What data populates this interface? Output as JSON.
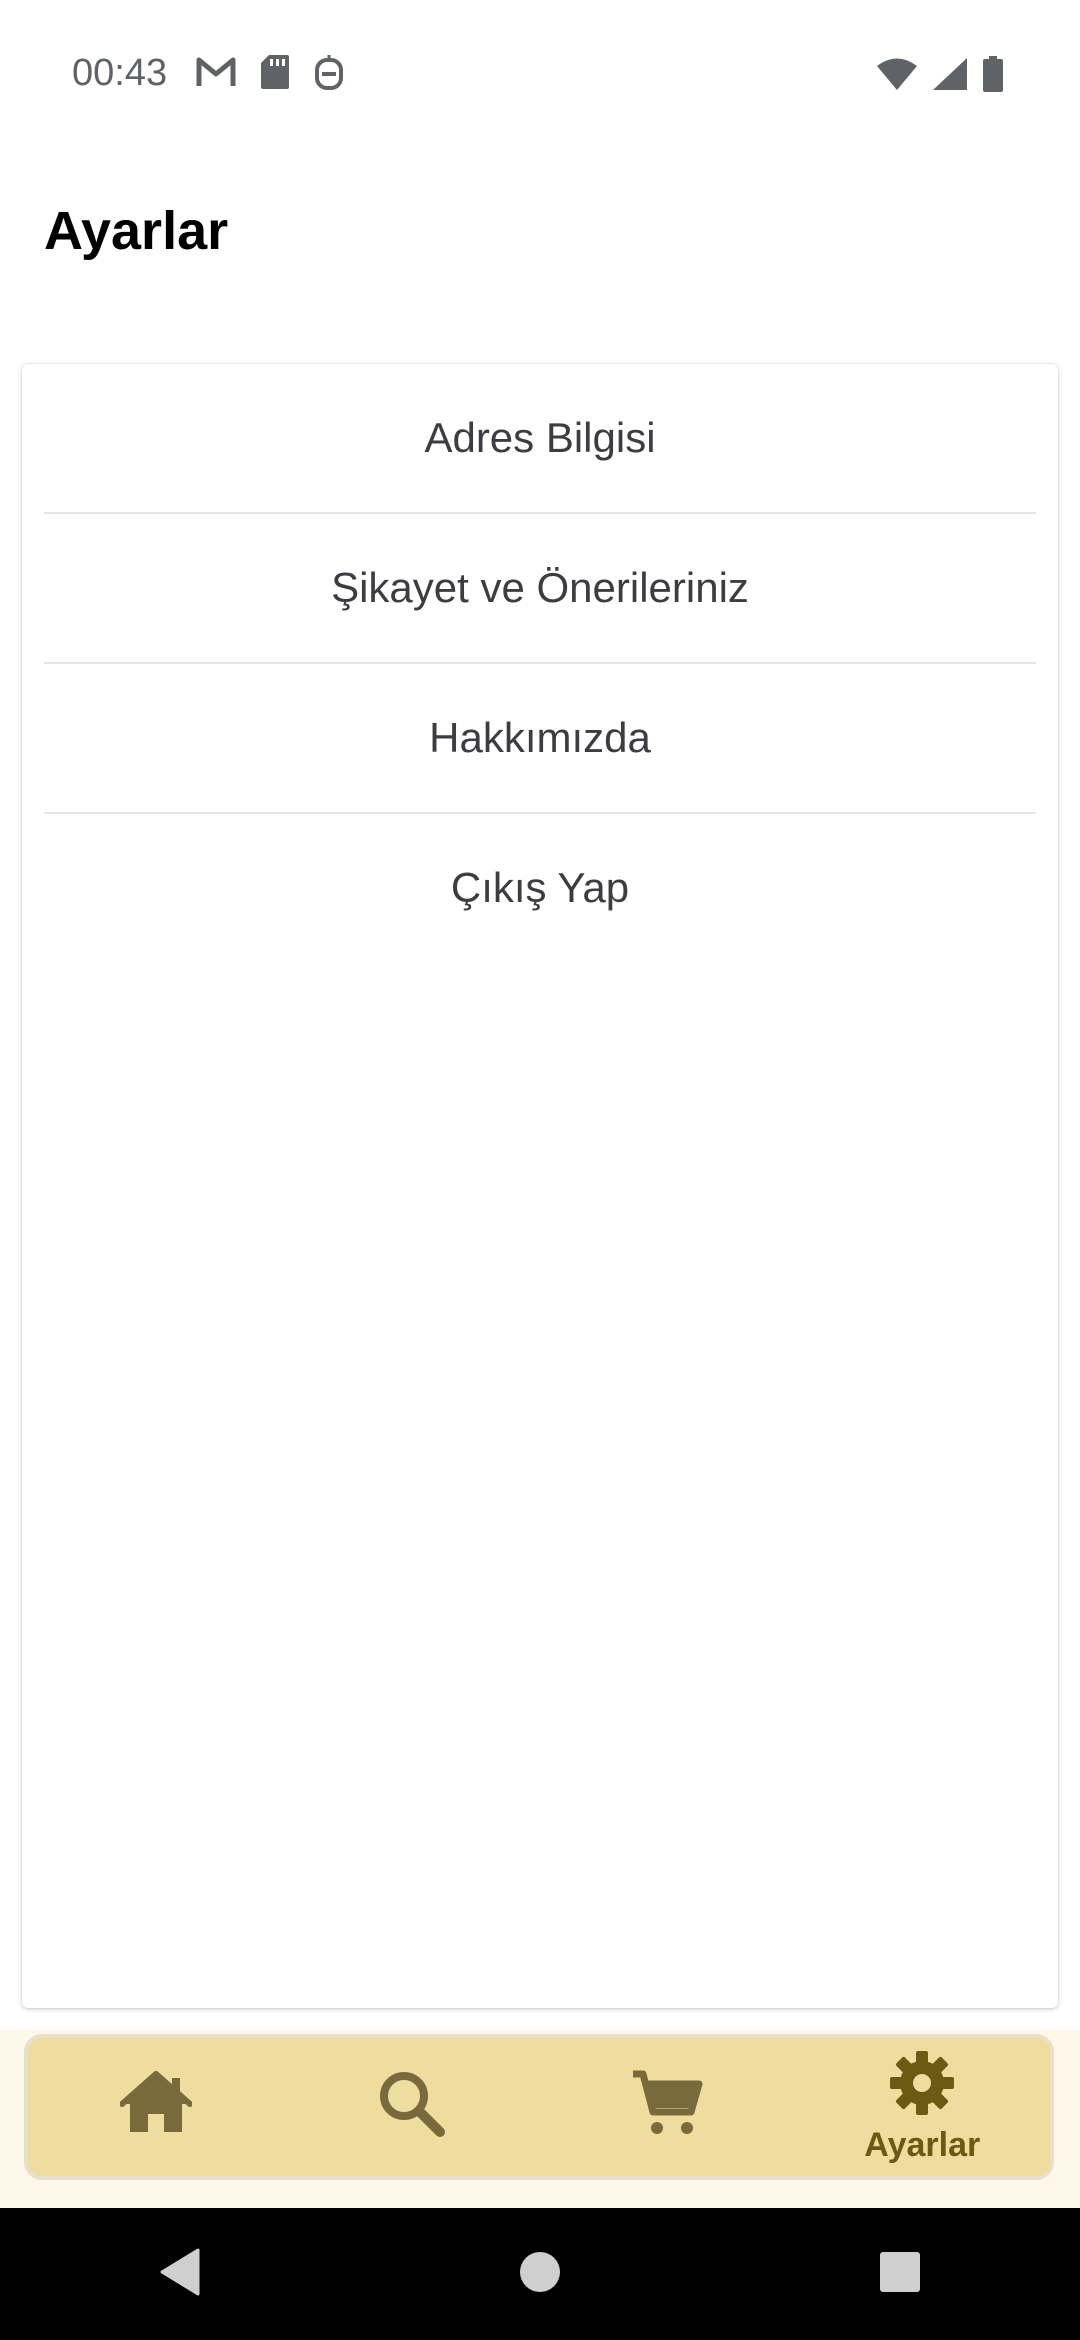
{
  "status_bar": {
    "time": "00:43",
    "left_icons": [
      "gmail-icon",
      "sd-card-icon",
      "assistant-icon"
    ],
    "right_icons": [
      "wifi-icon",
      "signal-icon",
      "battery-icon"
    ]
  },
  "header": {
    "title": "Ayarlar"
  },
  "settings": {
    "items": [
      {
        "label": "Adres Bilgisi"
      },
      {
        "label": "Şikayet ve Önerileriniz"
      },
      {
        "label": "Hakkımızda"
      },
      {
        "label": "Çıkış Yap"
      }
    ]
  },
  "bottom_nav": {
    "items": [
      {
        "icon": "home-icon",
        "label": ""
      },
      {
        "icon": "search-icon",
        "label": ""
      },
      {
        "icon": "cart-icon",
        "label": ""
      },
      {
        "icon": "gear-icon",
        "label": "Ayarlar",
        "selected": true
      }
    ],
    "colors": {
      "background": "#efdc9f",
      "icon": "#6b5a12",
      "icon_inactive": "#786a3a"
    }
  },
  "system_nav": {
    "buttons": [
      "back-icon",
      "home-circle-icon",
      "recents-icon"
    ]
  }
}
